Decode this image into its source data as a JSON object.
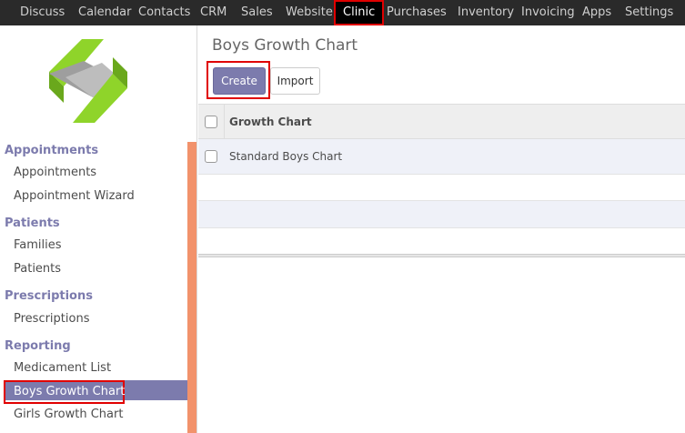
{
  "topnav": {
    "items": [
      {
        "label": "Discuss"
      },
      {
        "label": "Calendar"
      },
      {
        "label": "Contacts"
      },
      {
        "label": "CRM"
      },
      {
        "label": "Sales"
      },
      {
        "label": "Website"
      },
      {
        "label": "Clinic",
        "active": true
      },
      {
        "label": "Purchases"
      },
      {
        "label": "Inventory"
      },
      {
        "label": "Invoicing"
      },
      {
        "label": "Apps"
      },
      {
        "label": "Settings"
      }
    ]
  },
  "sidebar": {
    "sections": [
      {
        "title": "Appointments",
        "items": [
          "Appointments",
          "Appointment Wizard"
        ]
      },
      {
        "title": "Patients",
        "items": [
          "Families",
          "Patients"
        ]
      },
      {
        "title": "Prescriptions",
        "items": [
          "Prescriptions"
        ]
      },
      {
        "title": "Reporting",
        "items": [
          "Medicament List",
          "Boys Growth Chart",
          "Girls Growth Chart"
        ]
      }
    ],
    "selected_item": "Boys Growth Chart"
  },
  "main": {
    "title": "Boys Growth Chart",
    "create_label": "Create",
    "import_label": "Import",
    "table": {
      "header": "Growth Chart",
      "rows": [
        "Standard Boys Chart"
      ]
    }
  },
  "colors": {
    "accent": "#7c7bad",
    "highlight_border": "#e00000",
    "topbar": "#2a2a2a",
    "scrollbar": "#f2926b"
  }
}
